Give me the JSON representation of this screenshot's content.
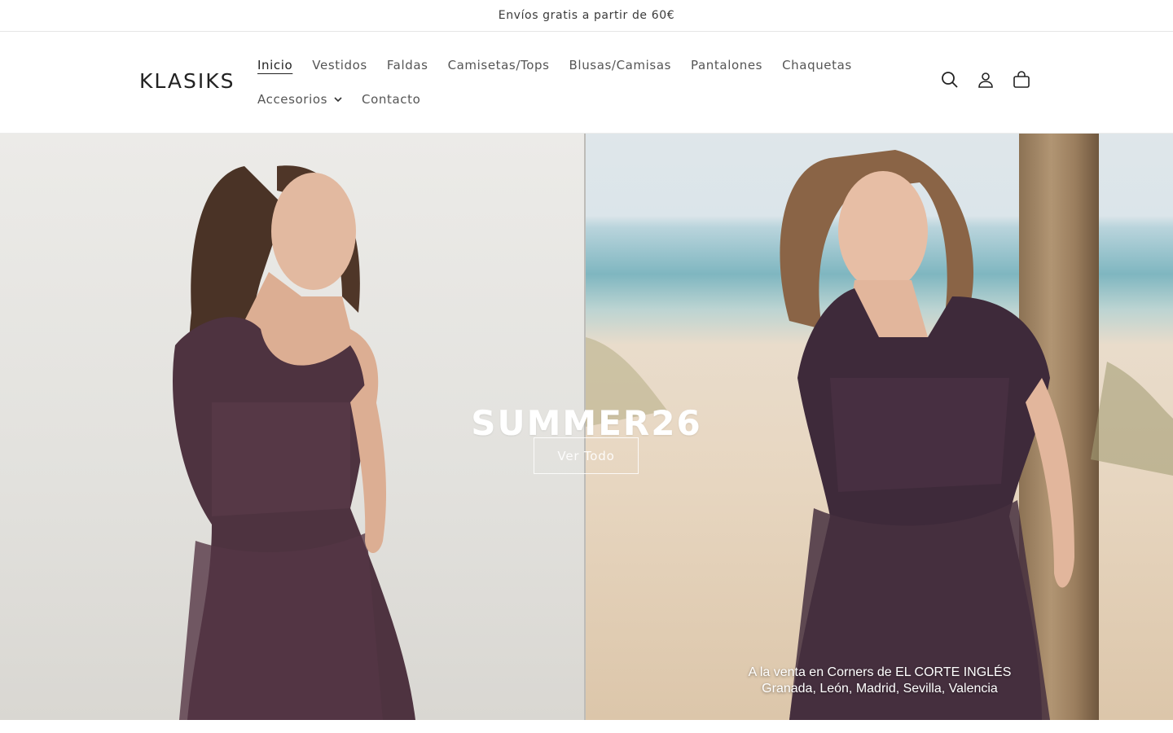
{
  "announcement": {
    "text": "Envíos gratis a partir de 60€"
  },
  "header": {
    "logo": "KLASIKS",
    "nav": {
      "row1": [
        "Inicio",
        "Vestidos",
        "Faldas",
        "Camisetas/Tops",
        "Blusas/Camisas",
        "Pantalones",
        "Chaquetas"
      ],
      "row2": [
        "Accesorios",
        "Contacto"
      ]
    },
    "active_item": "Inicio",
    "icons": [
      "search-icon",
      "account-icon",
      "cart-icon"
    ]
  },
  "hero": {
    "title": "SUMMER26",
    "button_label": "Ver Todo",
    "caption_line1": "A la venta en Corners de EL CORTE INGLÉS",
    "caption_line2": "Granada, León, Madrid, Sevilla, Valencia"
  },
  "colors": {
    "text": "#333333",
    "hero_text": "#ffffff",
    "border": "#e6e6e6"
  }
}
